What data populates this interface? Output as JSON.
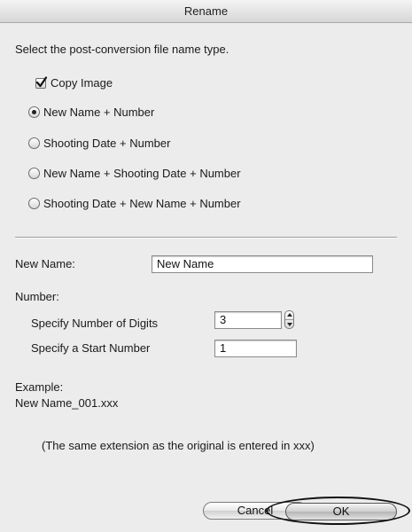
{
  "window": {
    "title": "Rename"
  },
  "instruction": "Select the post-conversion file name type.",
  "copy_image": {
    "label": "Copy Image",
    "checked": true
  },
  "name_types": [
    {
      "label": "New Name + Number",
      "selected": true
    },
    {
      "label": "Shooting Date + Number",
      "selected": false
    },
    {
      "label": "New Name + Shooting Date + Number",
      "selected": false
    },
    {
      "label": "Shooting Date + New Name + Number",
      "selected": false
    }
  ],
  "new_name": {
    "label": "New Name:",
    "value": "New Name"
  },
  "number": {
    "label": "Number:",
    "digits_label": "Specify Number of Digits",
    "digits_value": "3",
    "start_label": "Specify a Start Number",
    "start_value": "1"
  },
  "example": {
    "label": "Example:",
    "value": "New Name_001.xxx"
  },
  "note": "(The same extension as the original is entered in xxx)",
  "buttons": {
    "cancel": "Cancel",
    "ok": "OK"
  },
  "icons": {
    "checkbox": "checkmark-icon",
    "stepper": "stepper-arrows-icon"
  }
}
